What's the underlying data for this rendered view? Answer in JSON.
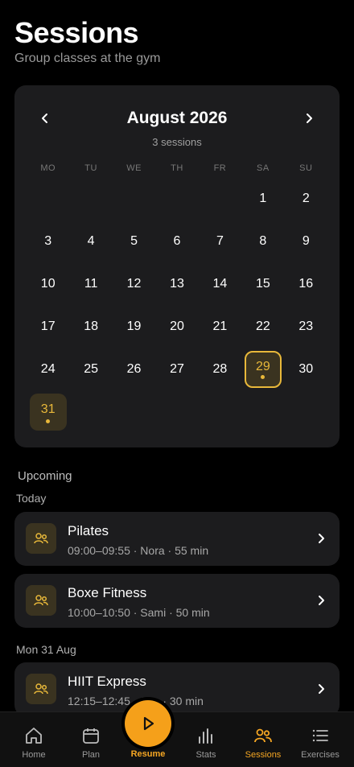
{
  "header": {
    "title": "Sessions",
    "subtitle": "Group classes at the gym"
  },
  "calendar": {
    "month": "August 2026",
    "count": "3 sessions",
    "weekdays": [
      "MO",
      "TU",
      "WE",
      "TH",
      "FR",
      "SA",
      "SU"
    ],
    "days": [
      "1",
      "2",
      "3",
      "4",
      "5",
      "6",
      "7",
      "8",
      "9",
      "10",
      "11",
      "12",
      "13",
      "14",
      "15",
      "16",
      "17",
      "18",
      "19",
      "20",
      "21",
      "22",
      "23",
      "24",
      "25",
      "26",
      "27",
      "28",
      "29",
      "30",
      "31"
    ],
    "selected_day": "29",
    "session_days": [
      "29",
      "31"
    ]
  },
  "upcoming": {
    "label": "Upcoming",
    "groups": [
      {
        "label": "Today",
        "items": [
          {
            "title": "Pilates",
            "meta": "09:00–09:55 · Nora · 55 min"
          },
          {
            "title": "Boxe Fitness",
            "meta": "10:00–10:50 · Sami · 50 min"
          }
        ]
      },
      {
        "label": "Mon 31 Aug",
        "items": [
          {
            "title": "HIIT Express",
            "meta": "12:15–12:45 · Ana · 30 min"
          }
        ]
      }
    ]
  },
  "tabbar": {
    "home": "Home",
    "plan": "Plan",
    "resume": "Resume",
    "stats": "Stats",
    "sessions": "Sessions",
    "exercises": "Exercises"
  },
  "colors": {
    "accent": "#e8b83a",
    "fab": "#f5a01a",
    "card": "#1c1c1e"
  }
}
